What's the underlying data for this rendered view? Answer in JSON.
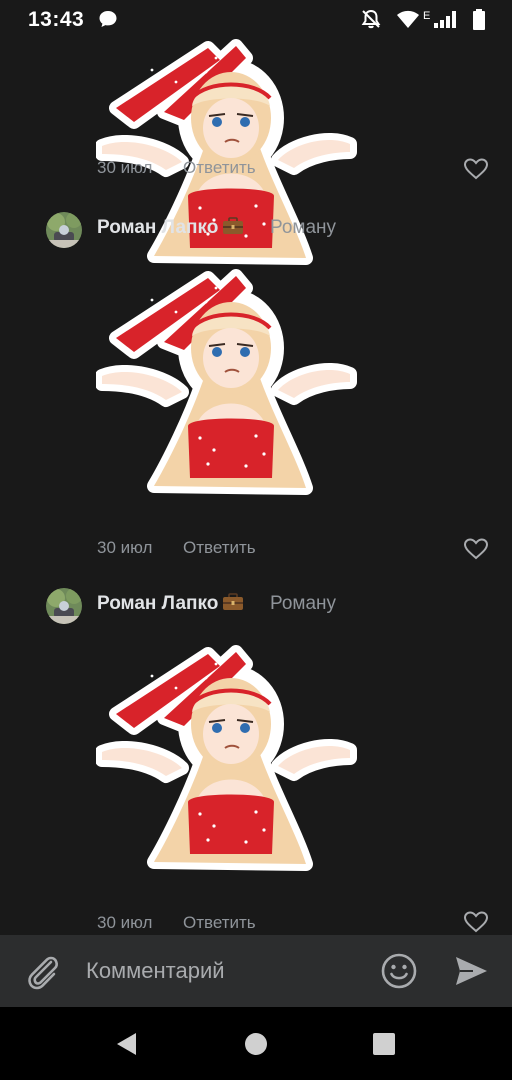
{
  "status_bar": {
    "time": "13:43",
    "network_label": "E",
    "icons": [
      "message-icon",
      "mute-icon",
      "wifi-icon",
      "signal-icon",
      "battery-icon"
    ]
  },
  "comments": [
    {
      "date": "30 июл",
      "reply_label": "Ответить",
      "sticker": "bunny-girl-shrug-sticker"
    },
    {
      "author": "Роман Лапко",
      "author_badge": "briefcase-icon",
      "reply_to": "Роману",
      "sticker": "bunny-girl-shrug-sticker",
      "date": "30 июл",
      "reply_label": "Ответить"
    },
    {
      "author": "Роман Лапко",
      "author_badge": "briefcase-icon",
      "reply_to": "Роману",
      "sticker": "bunny-girl-shrug-sticker",
      "date": "30 июл",
      "reply_label": "Ответить"
    }
  ],
  "composer": {
    "placeholder": "Комментарий",
    "icons": [
      "paperclip-icon",
      "smiley-icon",
      "send-icon"
    ]
  },
  "nav_bar": {
    "icons": [
      "back-icon",
      "home-icon",
      "recents-icon"
    ]
  },
  "colors": {
    "background": "#191919",
    "composer_background": "#2c2d2e",
    "text_primary": "#e1e3e6",
    "text_secondary": "#8f949a",
    "sticker_red": "#d8232a"
  }
}
